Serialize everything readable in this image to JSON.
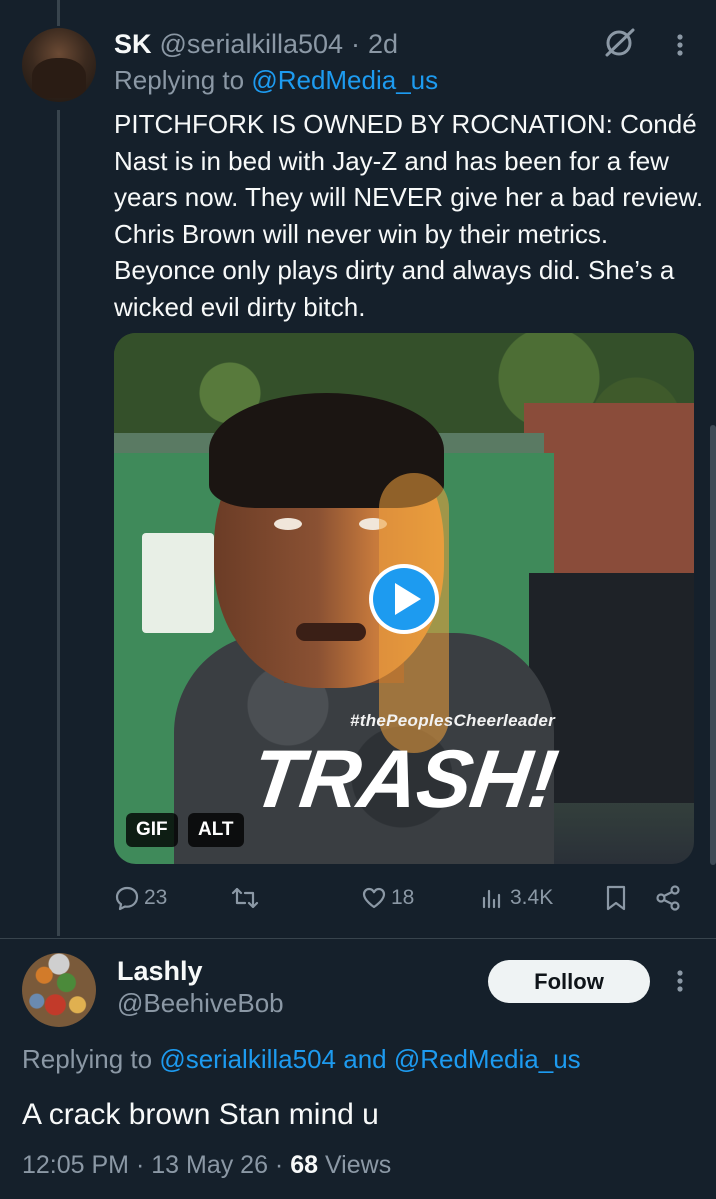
{
  "tweet1": {
    "name": "SK",
    "handle": "@serialkilla504",
    "dot": "·",
    "time": "2d",
    "reply_prefix": "Replying to ",
    "reply_to": "@RedMedia_us",
    "body": "PITCHFORK IS OWNED BY ROCNATION: Condé Nast is in bed with Jay-Z and has been for a few years now. They will NEVER give her a bad review. Chris Brown will never win by their metrics. Beyonce only plays dirty and always did. She’s a wicked evil dirty bitch.",
    "media": {
      "hashtag": "#thePeoplesCheerleader",
      "overlay_text": "TRASH!",
      "badge_gif": "GIF",
      "badge_alt": "ALT"
    },
    "actions": {
      "replies": "23",
      "reposts": "",
      "likes": "18",
      "views": "3.4K"
    }
  },
  "tweet2": {
    "name": "Lashly",
    "handle": "@BeehiveBob",
    "follow_label": "Follow",
    "reply_prefix": "Replying to ",
    "reply_to_1": "@serialkilla504",
    "reply_and": " and ",
    "reply_to_2": "@RedMedia_us",
    "body": "A crack brown Stan mind u",
    "time": "12:05 PM",
    "sep1": " · ",
    "date": "13 May 26",
    "sep2": " · ",
    "views_count": "68",
    "views_label": " Views"
  },
  "colors": {
    "background": "#15202b",
    "accent": "#1d9bf0",
    "muted_text": "#8b98a5",
    "primary_text": "#f7f9f9"
  },
  "icons": {
    "grok": "grok-icon",
    "more": "more-dots-icon",
    "reply": "reply-icon",
    "repost": "repost-icon",
    "like": "heart-icon",
    "views": "views-icon",
    "bookmark": "bookmark-icon",
    "share": "share-icon",
    "play": "play-icon"
  }
}
